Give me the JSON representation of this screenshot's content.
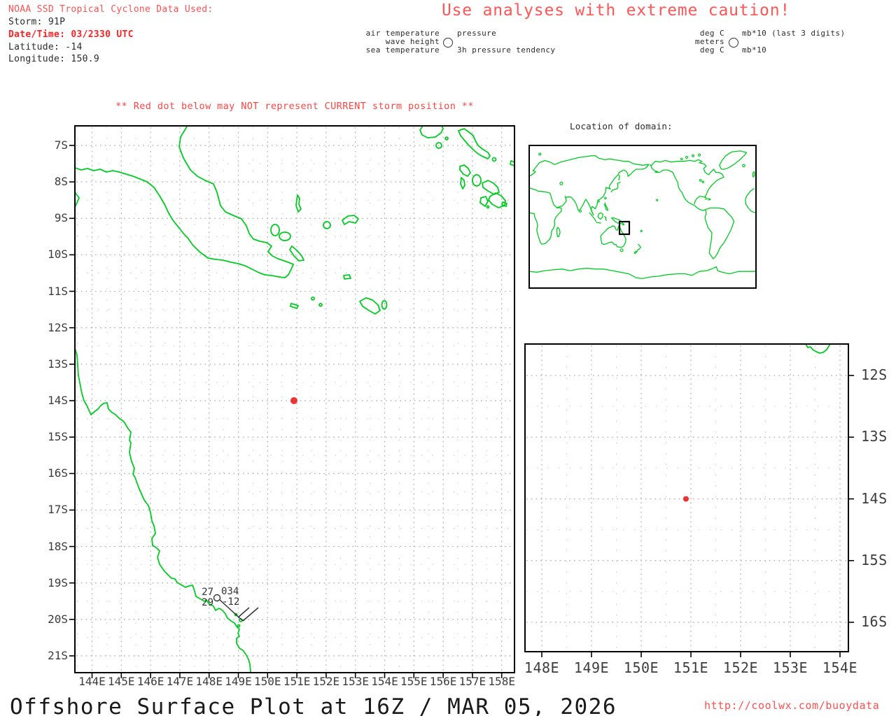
{
  "storm_info": {
    "source_label": "NOAA SSD Tropical Cyclone Data Used:",
    "storm": "Storm: 91P",
    "datetime": "Date/Time: 03/2330 UTC",
    "latitude": "Latitude: -14",
    "longitude": "Longitude: 150.9"
  },
  "caution_banner": "Use analyses with extreme caution!",
  "station_legend": {
    "left": [
      "air temperature",
      "wave height",
      "sea temperature"
    ],
    "right": [
      "pressure",
      "3h pressure tendency"
    ]
  },
  "units_legend": {
    "left": [
      "deg C",
      "meters",
      "deg C"
    ],
    "right": [
      "mb*10 (last 3 digits)",
      "mb*10"
    ]
  },
  "warning": "** Red dot below may NOT represent CURRENT storm position **",
  "main_map": {
    "x_labels": [
      "144E",
      "145E",
      "146E",
      "147E",
      "148E",
      "149E",
      "150E",
      "151E",
      "152E",
      "153E",
      "154E",
      "155E",
      "156E",
      "157E",
      "158E"
    ],
    "y_labels": [
      "7S",
      "8S",
      "9S",
      "10S",
      "11S",
      "12S",
      "13S",
      "14S",
      "15S",
      "16S",
      "17S",
      "18S",
      "19S",
      "20S",
      "21S"
    ],
    "station_report": {
      "air_temperature": "27",
      "sea_temperature": "29",
      "pressure": "034",
      "pressure_tendency": "-12"
    }
  },
  "storm_position": {
    "lon": 150.9,
    "lat": -14
  },
  "inset_map": {
    "title": "Location of domain:"
  },
  "zoom_map": {
    "x_labels": [
      "148E",
      "149E",
      "150E",
      "151E",
      "152E",
      "153E",
      "154E"
    ],
    "y_labels": [
      "12S",
      "13S",
      "14S",
      "15S",
      "16S"
    ]
  },
  "footer": {
    "title": "Offshore Surface Plot at 16Z / MAR 05, 2026",
    "url": "http://coolwx.com/buoydata"
  },
  "colors": {
    "coastline": "#00cc22",
    "header_red": "#ff5050",
    "alert_red": "#ff2222",
    "storm_dot": "#ee3333",
    "grid_dot": "#a8a8a8"
  }
}
